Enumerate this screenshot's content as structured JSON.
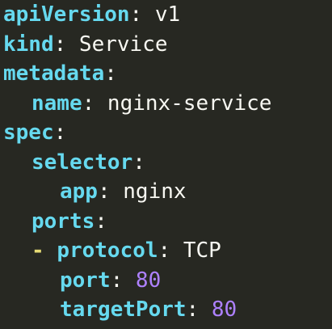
{
  "editor": {
    "lines": [
      {
        "key": "apiVersion",
        "colon": ":",
        "value": " v1"
      },
      {
        "key": "kind",
        "colon": ":",
        "value": " Service"
      },
      {
        "key": "metadata",
        "colon": ":"
      },
      {
        "key": "name",
        "colon": ":",
        "value": " nginx-service"
      },
      {
        "key": "spec",
        "colon": ":"
      },
      {
        "key": "selector",
        "colon": ":"
      },
      {
        "key": "app",
        "colon": ":",
        "value": " nginx"
      },
      {
        "key": "ports",
        "colon": ":"
      },
      {
        "dash": "- ",
        "key": "protocol",
        "colon": ":",
        "value": " TCP"
      },
      {
        "key": "port",
        "colon": ":",
        "value": " 80"
      },
      {
        "key": "targetPort",
        "colon": ":",
        "value": " 80"
      }
    ]
  },
  "colors": {
    "background": "#272822",
    "key": "#66d9ef",
    "text": "#f8f8f2",
    "number": "#ae81ff",
    "dash": "#e6db74"
  }
}
